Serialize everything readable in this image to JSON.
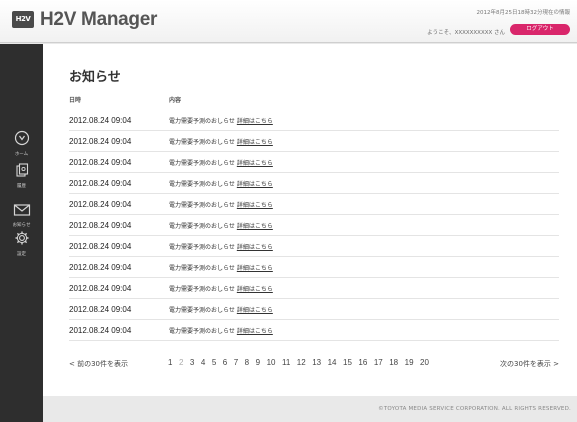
{
  "header": {
    "logo_text": "H2V",
    "app_title": "H2V Manager",
    "timestamp": "2012年8月25日18時32分現在の情報",
    "greeting": "ようこそ、XXXXXXXXXX さん",
    "logout_label": "ログアウト"
  },
  "sidebar": {
    "items": [
      {
        "label": "ホーム",
        "icon": "home-icon"
      },
      {
        "label": "履歴",
        "icon": "history-icon"
      },
      {
        "label": "お知らせ",
        "icon": "mail-icon"
      },
      {
        "label": "設定",
        "icon": "gear-icon"
      }
    ]
  },
  "main": {
    "title": "お知らせ",
    "columns": {
      "date": "日時",
      "content": "内容"
    },
    "rows": [
      {
        "date": "2012.08.24 09:04",
        "text": "電力需要予測のおしらせ",
        "link": "詳細はこちら"
      },
      {
        "date": "2012.08.24 09:04",
        "text": "電力需要予測のおしらせ",
        "link": "詳細はこちら"
      },
      {
        "date": "2012.08.24 09:04",
        "text": "電力需要予測のおしらせ",
        "link": "詳細はこちら"
      },
      {
        "date": "2012.08.24 09:04",
        "text": "電力需要予測のおしらせ",
        "link": "詳細はこちら"
      },
      {
        "date": "2012.08.24 09:04",
        "text": "電力需要予測のおしらせ",
        "link": "詳細はこちら"
      },
      {
        "date": "2012.08.24 09:04",
        "text": "電力需要予測のおしらせ",
        "link": "詳細はこちら"
      },
      {
        "date": "2012.08.24 09:04",
        "text": "電力需要予測のおしらせ",
        "link": "詳細はこちら"
      },
      {
        "date": "2012.08.24 09:04",
        "text": "電力需要予測のおしらせ",
        "link": "詳細はこちら"
      },
      {
        "date": "2012.08.24 09:04",
        "text": "電力需要予測のおしらせ",
        "link": "詳細はこちら"
      },
      {
        "date": "2012.08.24 09:04",
        "text": "電力需要予測のおしらせ",
        "link": "詳細はこちら"
      },
      {
        "date": "2012.08.24 09:04",
        "text": "電力需要予測のおしらせ",
        "link": "詳細はこちら"
      }
    ]
  },
  "pagination": {
    "prev_label": "< 前の30件を表示",
    "next_label": "次の30件を表示 >",
    "pages": [
      "1",
      "2",
      "3",
      "4",
      "5",
      "6",
      "7",
      "8",
      "9",
      "10",
      "11",
      "12",
      "13",
      "14",
      "15",
      "16",
      "17",
      "18",
      "19",
      "20"
    ],
    "current_page": "2"
  },
  "footer": {
    "copyright": "©TOYOTA MEDIA SERVICE CORPORATION. ALL RIGHTS RESERVED."
  },
  "colors": {
    "accent": "#d9266b",
    "sidebar_bg": "#2e2e2e"
  }
}
